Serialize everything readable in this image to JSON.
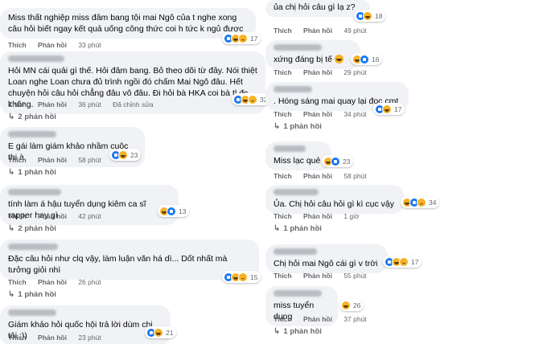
{
  "left": [
    {
      "text": "Miss thất nghiệp miss đâm bang tội mai Ngô của t nghe xong câu hỏi biết ngay kết quả uống công thức coi h tức k ngủ được",
      "like": "Thích",
      "reply": "Phản hồi",
      "time": "33 phút",
      "reacts": [
        "like",
        "haha",
        "sad"
      ],
      "count": "17"
    },
    {
      "text": "Hỏi MN cái quải gì thế. Hỏi đâm bang. Bỏ theo dõi từ đây. Nói thiệt Loan nghe Loan chưa đủ trình ngồi đó chấm Mai Ngô đâu. Hết chuyện hỏi câu hỏi chẳng đâu vô đâu. Ði hỏi bà HKA coi bà tl đc không.",
      "like": "Thích",
      "reply": "Phản hồi",
      "time": "36 phút",
      "edited": "Đã chỉnh sửa",
      "reacts": [
        "like",
        "haha",
        "sad"
      ],
      "count": "32",
      "replies": "2 phản hồi"
    },
    {
      "text": "E gái làm giám khảo nhầm cuộc thi à",
      "like": "Thích",
      "reply": "Phản hồi",
      "time": "58 phút",
      "reacts": [
        "like",
        "haha"
      ],
      "count": "23",
      "replies": "1 phản hồi"
    },
    {
      "text": "tính làm á hậu tuyển dụng kiêm ca sĩ rapper hay gì",
      "like": "Thích",
      "reply": "Phản hồi",
      "time": "42 phút",
      "reacts": [
        "haha",
        "like"
      ],
      "count": "13",
      "replies": "2 phản hồi"
    },
    {
      "text": "Đặc câu hỏi như clq vậy, làm luận văn há dì... Dốt nhất mà tưởng giỏi nhì",
      "like": "Thích",
      "reply": "Phản hồi",
      "time": "26 phút",
      "reacts": [
        "like",
        "haha",
        "sad"
      ],
      "count": "15",
      "replies": "1 phản hồi"
    },
    {
      "text": "Giám khảo hỏi quốc hội trả lời dùm chị tôi :))",
      "like": "Thích",
      "reply": "Phản hồi",
      "time": "23 phút",
      "reacts": [
        "like",
        "haha"
      ],
      "count": "21"
    }
  ],
  "right": [
    {
      "text": "ủa chị hỏi câu gì lạ z?",
      "like": "Thích",
      "reply": "Phản hồi",
      "time": "49 phút",
      "reacts": [
        "like",
        "haha"
      ],
      "count": "18"
    },
    {
      "text": "xứng đáng bị tế",
      "emoji": true,
      "like": "Thích",
      "reply": "Phản hồi",
      "time": "29 phút",
      "reacts": [
        "haha",
        "like"
      ],
      "count": "16"
    },
    {
      "text": ". Hóng sáng mai quay lại đọc cmt",
      "like": "Thích",
      "reply": "Phản hồi",
      "time": "34 phút",
      "reacts": [
        "like",
        "haha"
      ],
      "count": "17",
      "replies": "1 phản hồi"
    },
    {
      "text": "Miss lạc quẻ",
      "like": "Thích",
      "reply": "Phản hồi",
      "time": "58 phút",
      "reacts": [
        "haha",
        "like"
      ],
      "count": "23"
    },
    {
      "text": "Ủa. Chị hỏi câu hỏi gì kì cục vậy",
      "like": "Thích",
      "reply": "Phản hồi",
      "time": "1 giờ",
      "reacts": [
        "haha",
        "like",
        "sad"
      ],
      "count": "34",
      "replies": "1 phản hồi"
    },
    {
      "text": "Chị hỏi mai Ngô cái gì v trời",
      "like": "Thích",
      "reply": "Phản hồi",
      "time": "55 phút",
      "reacts": [
        "like",
        "haha",
        "sad"
      ],
      "count": "17"
    },
    {
      "text": "miss tuyển dụng",
      "like": "Thích",
      "reply": "Phản hồi",
      "time": "37 phút",
      "reacts": [
        "haha"
      ],
      "count": "26",
      "replies": "1 phản hồi"
    }
  ]
}
